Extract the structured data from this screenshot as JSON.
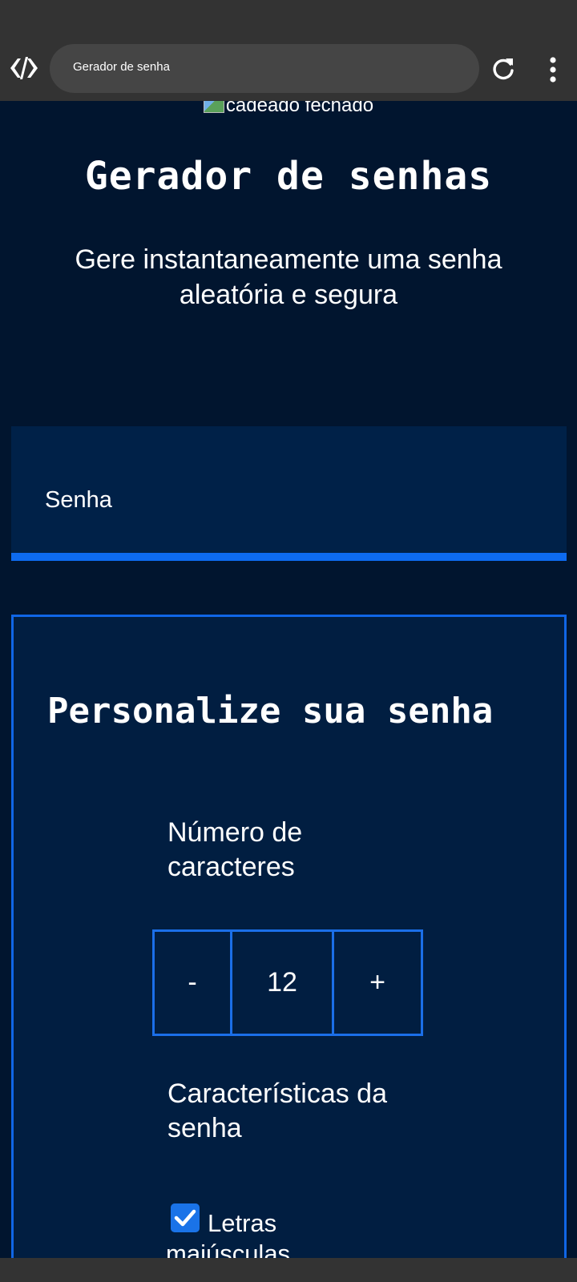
{
  "browser": {
    "url_text": "Gerador de senha",
    "icons": {
      "logo": "code-brackets-logo",
      "reload": "reload-icon",
      "menu": "more-vert-icon"
    }
  },
  "page": {
    "image_alt": "cadeado fechado",
    "title": "Gerador de senhas",
    "subtitle": "Gere instantaneamente uma senha aleatória e segura",
    "password_field_label": "Senha",
    "card": {
      "title": "Personalize sua senha",
      "length_label": "Número de caracteres",
      "stepper": {
        "minus": "-",
        "value": "12",
        "plus": "+"
      },
      "features_label": "Características da senha",
      "options": [
        {
          "label": "Letras maiúsculas",
          "checked": true
        }
      ]
    }
  },
  "colors": {
    "page_bg": "#01152f",
    "panel_bg": "#002148",
    "accent": "#0d6bf0",
    "chrome_bg": "#333333"
  }
}
